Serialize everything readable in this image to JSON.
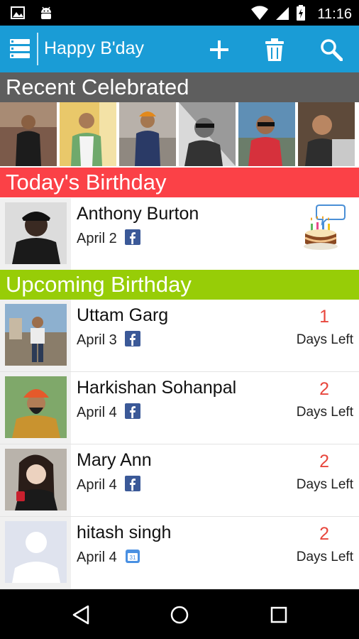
{
  "status_bar": {
    "time": "11:16"
  },
  "app_bar": {
    "title": "Happy B'day"
  },
  "sections": {
    "recent": "Recent Celebrated",
    "today": "Today's Birthday",
    "upcoming": "Upcoming Birthday"
  },
  "today": {
    "name": "Anthony Burton",
    "date": "April 2",
    "source": "facebook"
  },
  "upcoming": [
    {
      "name": "Uttam Garg",
      "date": "April 3",
      "source": "facebook",
      "days": "1",
      "days_label": "Days Left"
    },
    {
      "name": "Harkishan Sohanpal",
      "date": "April 4",
      "source": "facebook",
      "days": "2",
      "days_label": "Days Left"
    },
    {
      "name": "Mary Ann",
      "date": "April 4",
      "source": "facebook",
      "days": "2",
      "days_label": "Days Left"
    },
    {
      "name": "hitash singh",
      "date": "April 4",
      "source": "calendar",
      "days": "2",
      "days_label": "Days Left"
    }
  ],
  "colors": {
    "app_bar": "#1a9cd6",
    "recent_header": "#5e5e5e",
    "today_header": "#fb4147",
    "upcoming_header": "#97cd07",
    "days_count": "#e8473d"
  }
}
